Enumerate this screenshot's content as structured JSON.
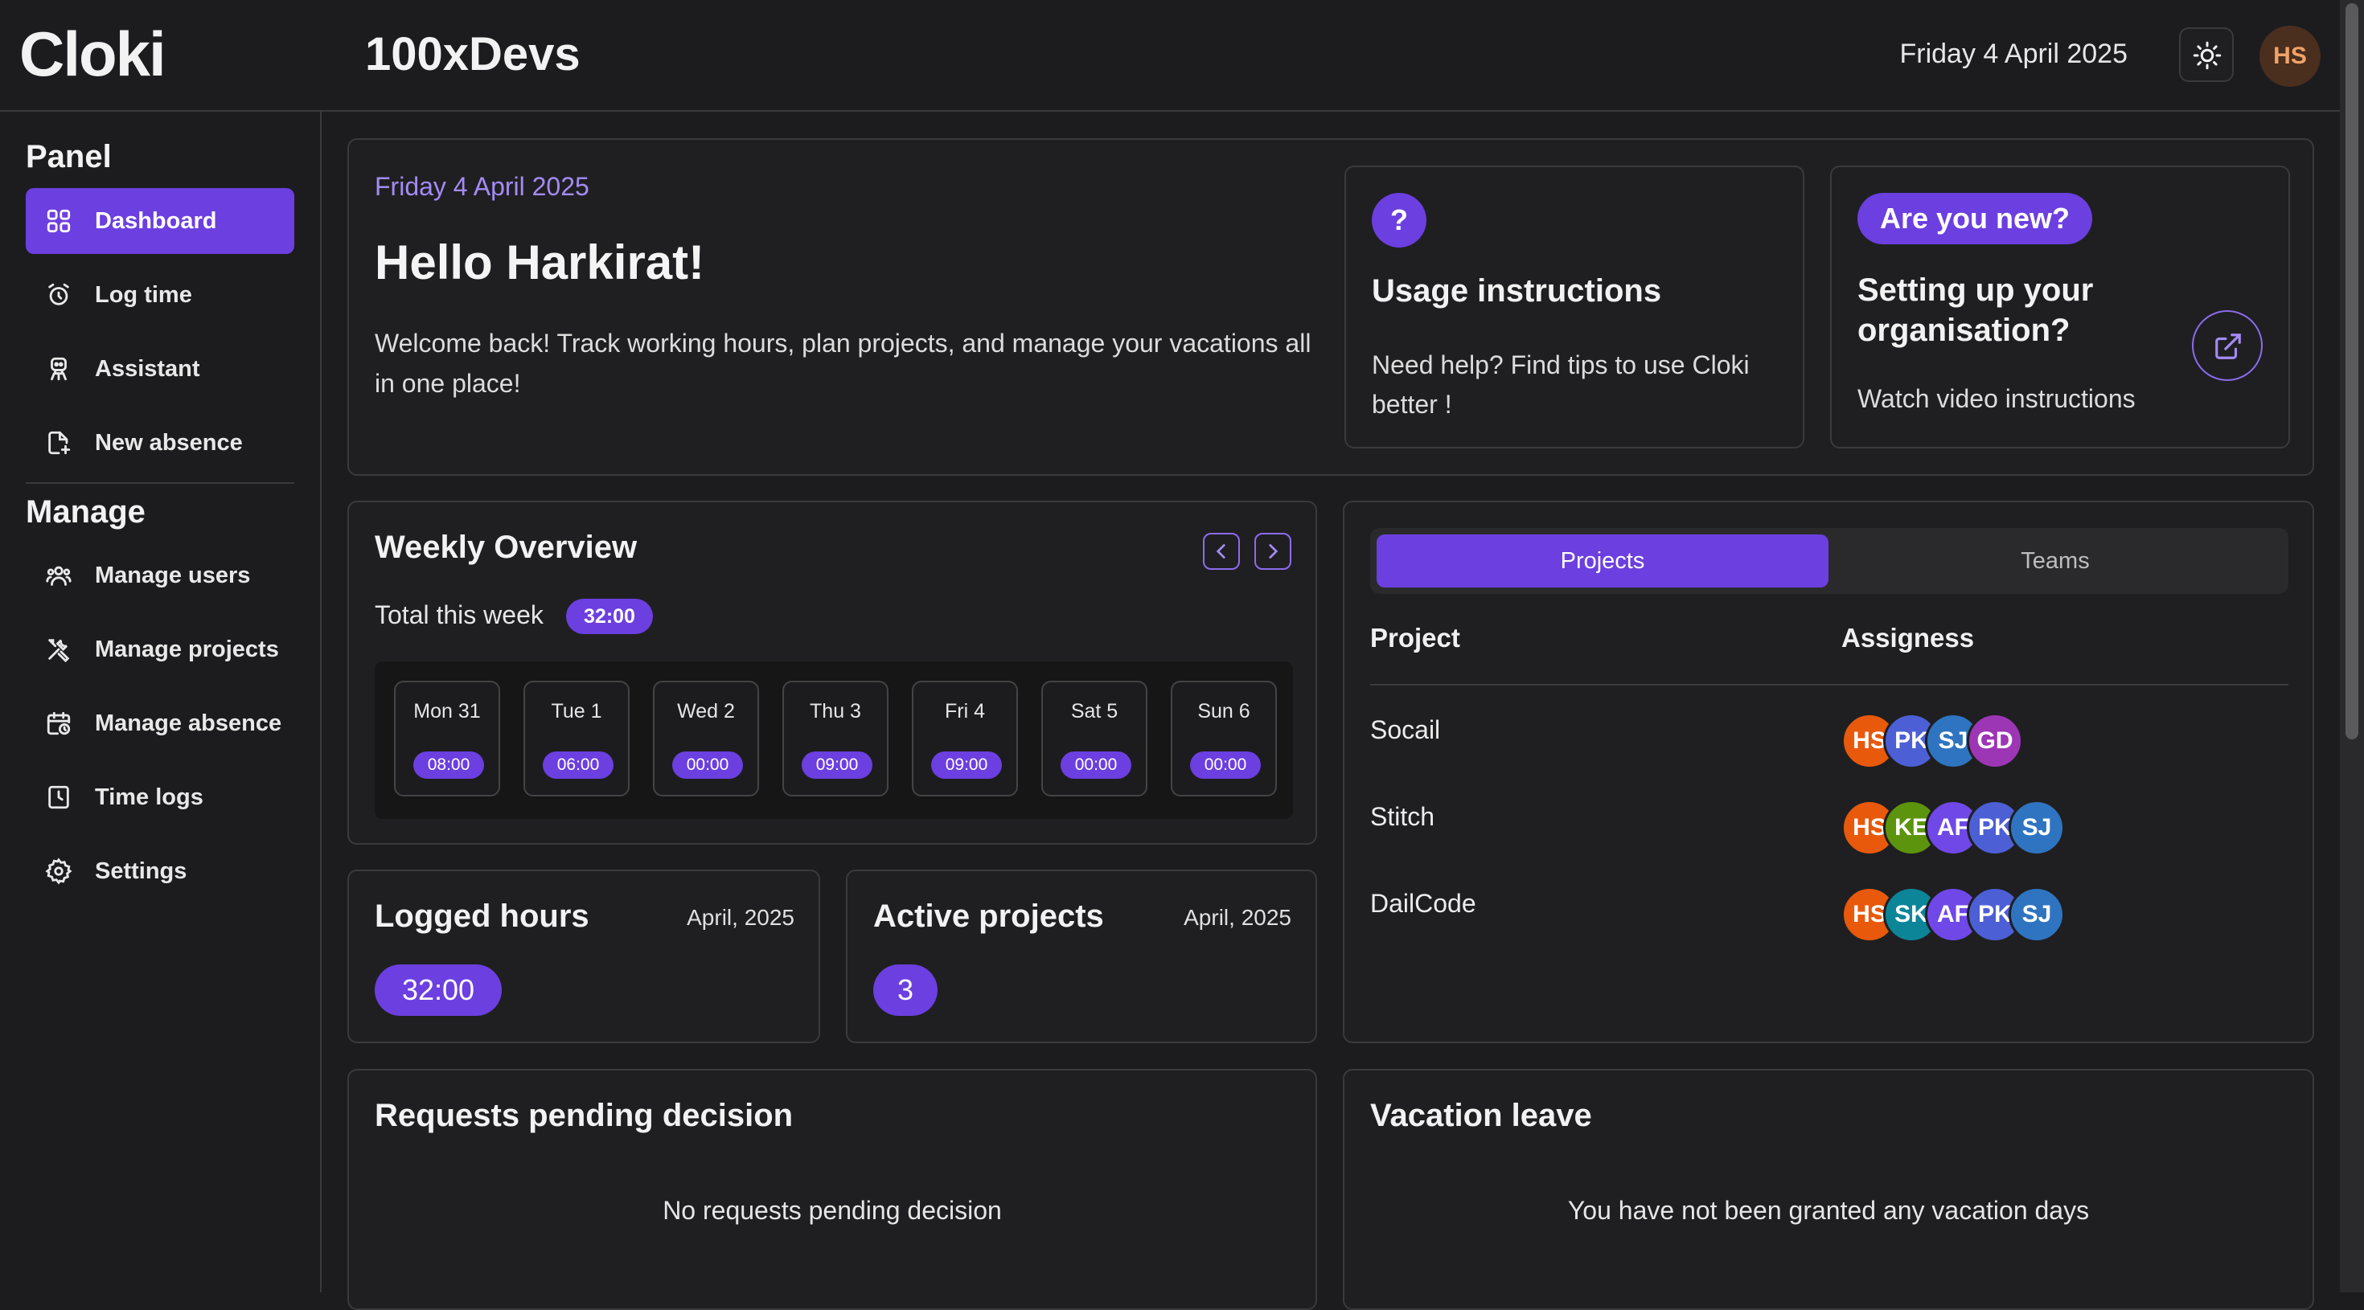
{
  "header": {
    "logo": "Cloki",
    "org_name": "100xDevs",
    "date": "Friday 4 April 2025",
    "avatar_initials": "HS",
    "theme_icon": "sun-icon"
  },
  "sidebar": {
    "panel_title": "Panel",
    "manage_title": "Manage",
    "panel_items": [
      {
        "label": "Dashboard",
        "icon": "grid-icon",
        "active": true
      },
      {
        "label": "Log time",
        "icon": "alarm-clock-icon"
      },
      {
        "label": "Assistant",
        "icon": "robot-icon"
      },
      {
        "label": "New absence",
        "icon": "file-plus-icon"
      }
    ],
    "manage_items": [
      {
        "label": "Manage users",
        "icon": "users-icon"
      },
      {
        "label": "Manage projects",
        "icon": "tools-icon"
      },
      {
        "label": "Manage absence",
        "icon": "calendar-clock-icon"
      },
      {
        "label": "Time logs",
        "icon": "clock-file-icon"
      },
      {
        "label": "Settings",
        "icon": "gear-icon"
      }
    ]
  },
  "welcome": {
    "date": "Friday 4 April 2025",
    "greeting": "Hello Harkirat!",
    "message": "Welcome back! Track working hours, plan projects, and manage your vacations all in one place!"
  },
  "usage": {
    "icon_text": "?",
    "title": "Usage instructions",
    "text": "Need help? Find tips to use Cloki better !"
  },
  "setup": {
    "badge": "Are you new?",
    "title": "Setting up your organisation?",
    "link_text": "Watch video instructions",
    "link_icon": "external-link-icon"
  },
  "weekly": {
    "title": "Weekly Overview",
    "total_label": "Total this week",
    "total_value": "32:00",
    "prev_icon": "chevron-left-icon",
    "next_icon": "chevron-right-icon",
    "days": [
      {
        "day": "Mon 31",
        "hours": "08:00"
      },
      {
        "day": "Tue 1",
        "hours": "06:00"
      },
      {
        "day": "Wed 2",
        "hours": "00:00"
      },
      {
        "day": "Thu 3",
        "hours": "09:00"
      },
      {
        "day": "Fri 4",
        "hours": "09:00"
      },
      {
        "day": "Sat 5",
        "hours": "00:00"
      },
      {
        "day": "Sun 6",
        "hours": "00:00"
      }
    ]
  },
  "logged_hours": {
    "title": "Logged hours",
    "period": "April, 2025",
    "value": "32:00"
  },
  "active_projects": {
    "title": "Active projects",
    "period": "April, 2025",
    "value": "3"
  },
  "projects_panel": {
    "tabs": [
      "Projects",
      "Teams"
    ],
    "active_tab": "Projects",
    "col_project": "Project",
    "col_assignees": "Assigness",
    "rows": [
      {
        "project": "Socail",
        "assignees": [
          {
            "initials": "HS",
            "color": "#e8590c"
          },
          {
            "initials": "PK",
            "color": "#4c5fd5"
          },
          {
            "initials": "SJ",
            "color": "#2f74c0"
          },
          {
            "initials": "GD",
            "color": "#9c36b5"
          }
        ]
      },
      {
        "project": "Stitch",
        "assignees": [
          {
            "initials": "HS",
            "color": "#e8590c"
          },
          {
            "initials": "KE",
            "color": "#5c940d"
          },
          {
            "initials": "AF",
            "color": "#7048e8"
          },
          {
            "initials": "PK",
            "color": "#4c5fd5"
          },
          {
            "initials": "SJ",
            "color": "#2f74c0"
          }
        ]
      },
      {
        "project": "DailCode",
        "assignees": [
          {
            "initials": "HS",
            "color": "#e8590c"
          },
          {
            "initials": "SK",
            "color": "#0c8599"
          },
          {
            "initials": "AF",
            "color": "#7048e8"
          },
          {
            "initials": "PK",
            "color": "#4c5fd5"
          },
          {
            "initials": "SJ",
            "color": "#2f74c0"
          }
        ]
      }
    ]
  },
  "requests": {
    "title": "Requests pending decision",
    "empty_text": "No requests pending decision"
  },
  "vacation": {
    "title": "Vacation leave",
    "empty_text": "You have not been granted any vacation days"
  },
  "colors": {
    "accent": "#6c3fe0",
    "accent_text": "#a48bf5",
    "background": "#1c1c1e",
    "border": "#3a3a3c"
  }
}
